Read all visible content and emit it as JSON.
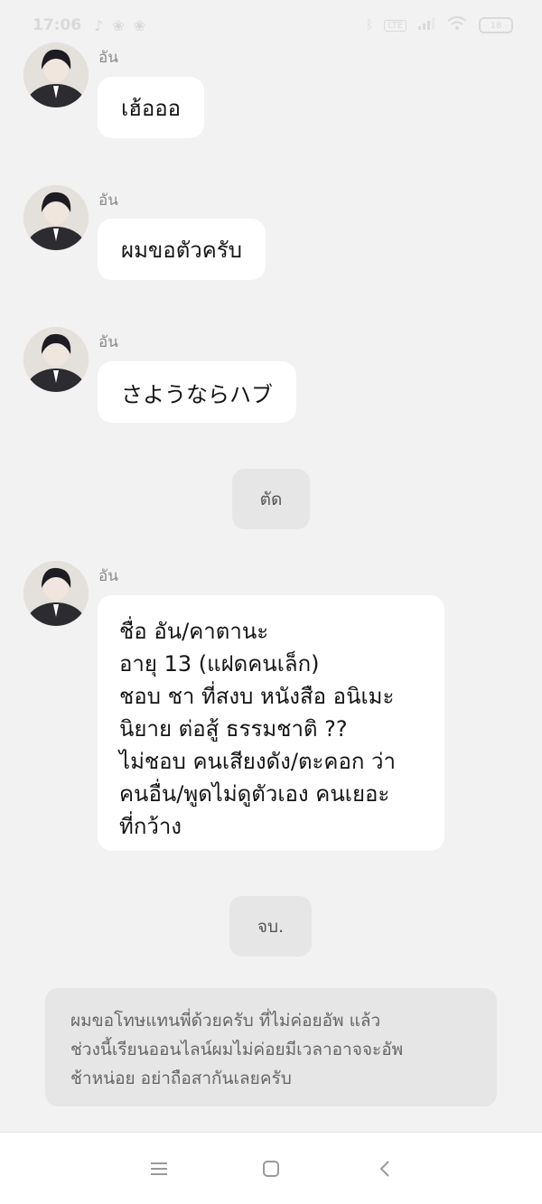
{
  "status_bar": {
    "time": "17:06",
    "left_icons": [
      "notification-icon",
      "paw-icon",
      "paw-icon"
    ],
    "network_label": "LTE",
    "battery": "18"
  },
  "messages": [
    {
      "sender": "อัน",
      "text": "เฮ้อออ"
    },
    {
      "sender": "อัน",
      "text": "ผมขอตัวครับ"
    },
    {
      "sender": "อัน",
      "text": "さようならハブ"
    },
    {
      "system": "ตัด"
    },
    {
      "sender": "อัน",
      "text": "ชื่อ อัน/คาตานะ\nอายุ 13 (แฝดคนเล็ก)\nชอบ ชา ที่สงบ หนังสือ อนิเมะ\nนิยาย ต่อสู้ ธรรมชาติ ??\nไม่ชอบ คนเสียงดัง/ตะคอก ว่า\nคนอื่น/พูดไม่ดูตัวเอง คนเยอะ\nที่กว้าง"
    },
    {
      "system": "จบ."
    }
  ],
  "notice": "ผมขอโทษแทนพี่ด้วยครับ ที่ไม่ค่อยอัพ แล้ว\nช่วงนี้เรียนออนไลน์ผมไม่ค่อยมีเวลาอาจจะอัพ\nช้าหน่อย อย่าถือสากันเลยครับ",
  "nav": {
    "buttons": [
      "menu-icon",
      "home-icon",
      "back-icon"
    ]
  },
  "colors": {
    "background": "#f2f2f2",
    "bubble": "#ffffff",
    "system_pill": "#e6e6e6"
  }
}
